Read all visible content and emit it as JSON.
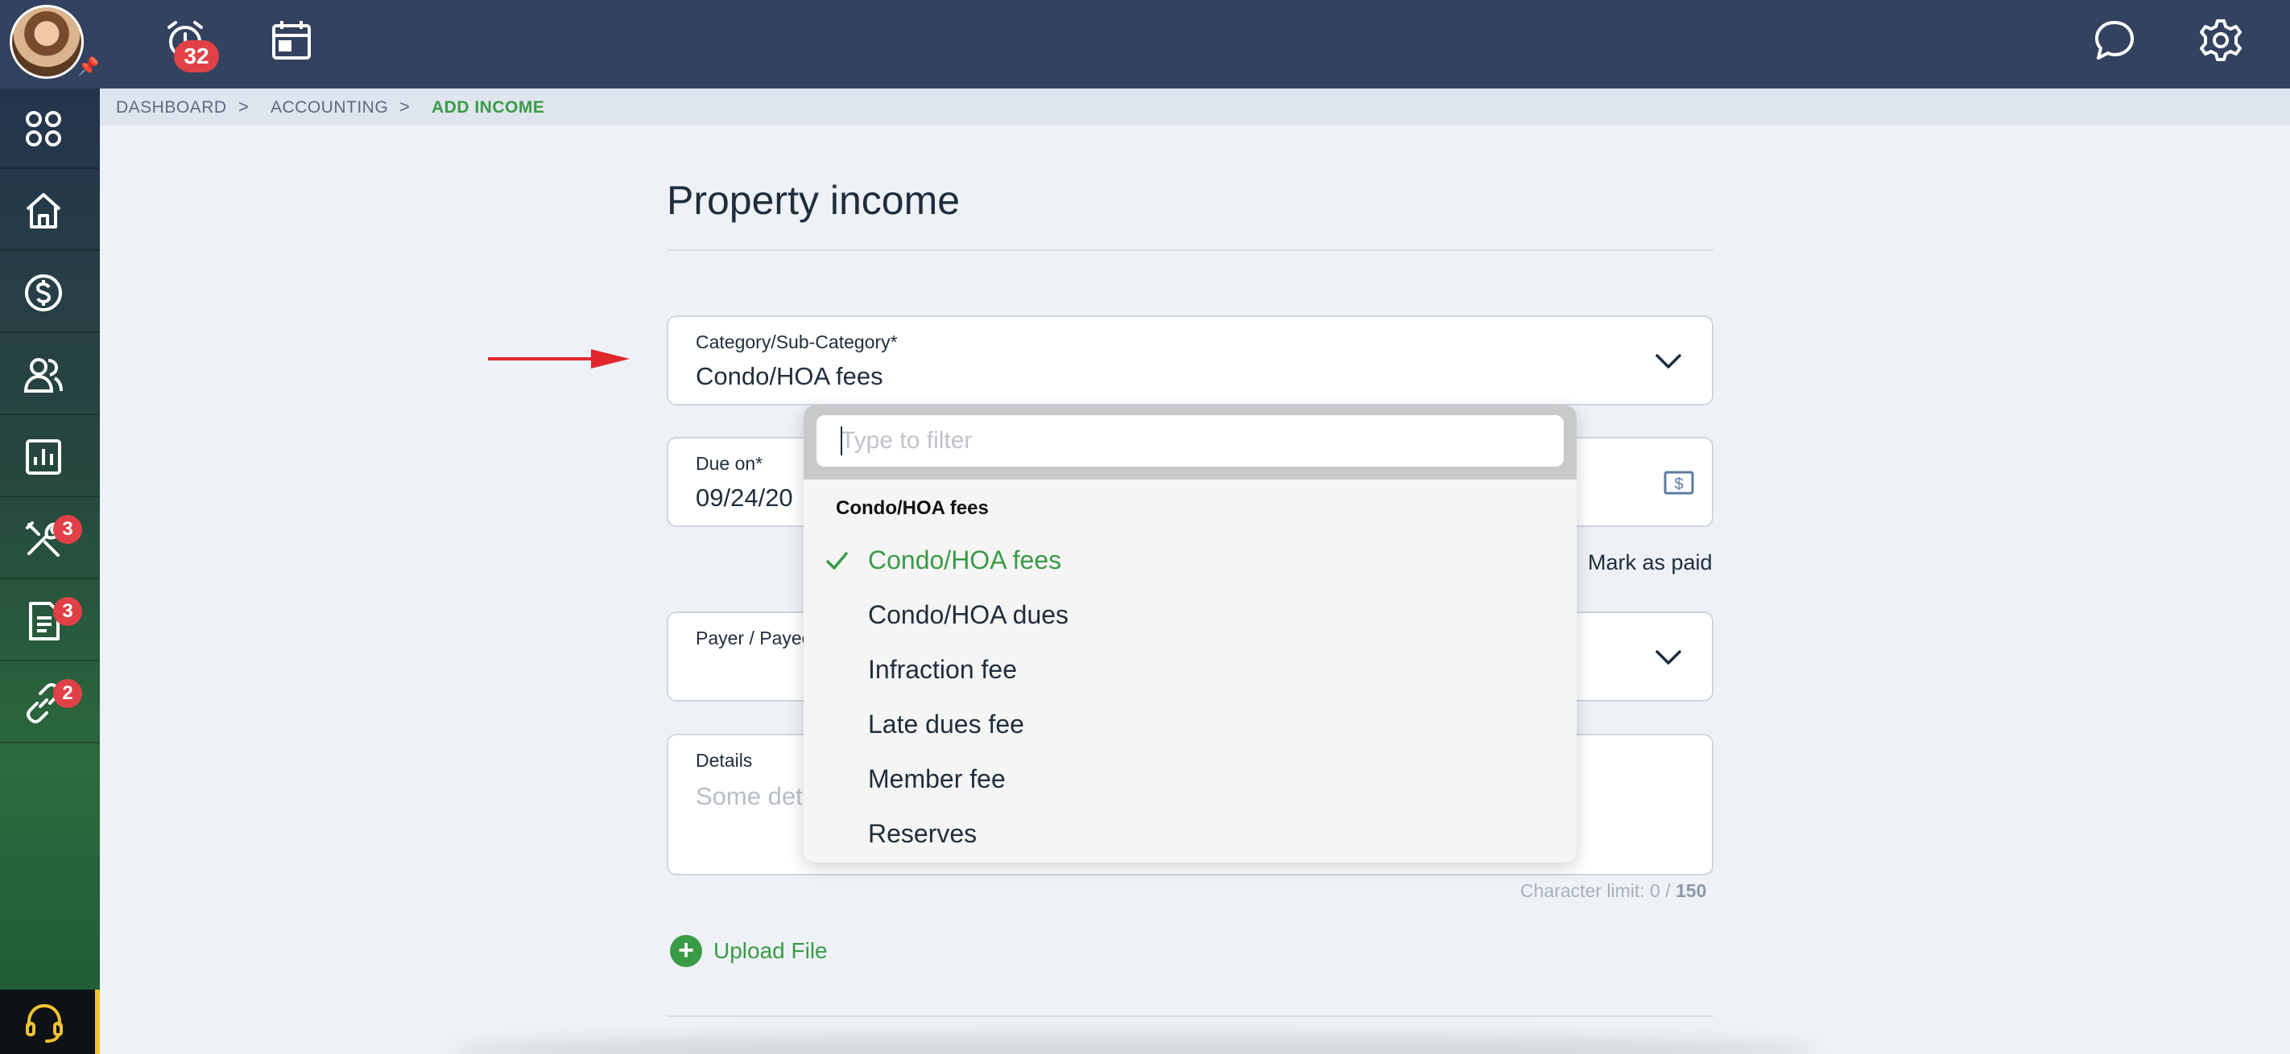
{
  "topbar": {
    "notifications_count": "32",
    "icons": [
      "alarm-icon",
      "calendar-icon",
      "chat-icon",
      "settings-icon"
    ]
  },
  "sidebar": {
    "items": [
      {
        "name": "apps-icon",
        "badge": ""
      },
      {
        "name": "home-icon",
        "badge": ""
      },
      {
        "name": "dollar-icon",
        "badge": ""
      },
      {
        "name": "people-icon",
        "badge": ""
      },
      {
        "name": "reports-icon",
        "badge": ""
      },
      {
        "name": "tools-icon",
        "badge": "3"
      },
      {
        "name": "document-icon",
        "badge": "3"
      },
      {
        "name": "link-icon",
        "badge": "2"
      }
    ],
    "support_icon": "headset-icon"
  },
  "breadcrumb": {
    "items": [
      "DASHBOARD",
      "ACCOUNTING",
      "ADD INCOME"
    ],
    "separator": ">"
  },
  "form": {
    "title": "Property income",
    "category": {
      "label": "Category/Sub-Category*",
      "value": "Condo/HOA fees"
    },
    "due_on": {
      "label": "Due on*",
      "value": "09/24/20"
    },
    "mark_as_paid": "Mark as paid",
    "payer": {
      "label": "Payer / Payee"
    },
    "details": {
      "label": "Details",
      "placeholder": "Some det"
    },
    "char_limit_prefix": "Character limit: 0 / ",
    "char_limit_max": "150",
    "upload_label": "Upload File"
  },
  "dropdown": {
    "filter_placeholder": "Type to filter",
    "group_label": "Condo/HOA fees",
    "options": [
      {
        "label": "Condo/HOA fees",
        "selected": true
      },
      {
        "label": "Condo/HOA dues",
        "selected": false
      },
      {
        "label": "Infraction fee",
        "selected": false
      },
      {
        "label": "Late dues fee",
        "selected": false
      },
      {
        "label": "Member fee",
        "selected": false
      },
      {
        "label": "Reserves",
        "selected": false
      }
    ]
  },
  "colors": {
    "accent_green": "#3a9b46",
    "topbar": "#33425e",
    "badge_red": "#e04146",
    "annotation_arrow": "#e0282c"
  }
}
